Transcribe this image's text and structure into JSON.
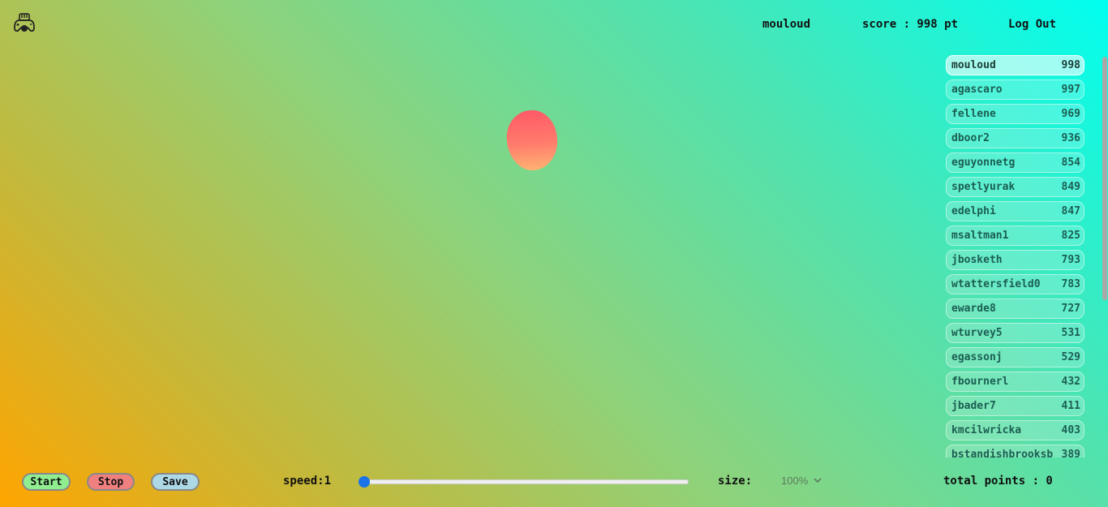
{
  "header": {
    "logo_icon": "gamepad-icon",
    "username": "mouloud",
    "score_label": "score : 998 pt",
    "logout_label": "Log Out"
  },
  "game": {
    "blob_colors": [
      "#ff5a67",
      "#ffb272"
    ]
  },
  "leaderboard": [
    {
      "name": "mouloud",
      "score": "998",
      "active": true
    },
    {
      "name": "agascaro",
      "score": "997"
    },
    {
      "name": "fellene",
      "score": "969"
    },
    {
      "name": "dboor2",
      "score": "936"
    },
    {
      "name": "eguyonnetg",
      "score": "854"
    },
    {
      "name": "spetlyurak",
      "score": "849"
    },
    {
      "name": "edelphi",
      "score": "847"
    },
    {
      "name": "msaltman1",
      "score": "825"
    },
    {
      "name": "jbosketh",
      "score": "793"
    },
    {
      "name": "wtattersfield0",
      "score": "783"
    },
    {
      "name": "ewarde8",
      "score": "727"
    },
    {
      "name": "wturvey5",
      "score": "531"
    },
    {
      "name": "egassonj",
      "score": "529"
    },
    {
      "name": "fbournerl",
      "score": "432"
    },
    {
      "name": "jbader7",
      "score": "411"
    },
    {
      "name": "kmcilwricka",
      "score": "403"
    },
    {
      "name": "bstandishbrooksb",
      "score": "389"
    }
  ],
  "controls": {
    "start_label": "Start",
    "stop_label": "Stop",
    "save_label": "Save",
    "speed_label": "speed:1",
    "speed_value": 1,
    "size_label": "size:",
    "size_value": "100%",
    "total_label": "total points : 0"
  }
}
